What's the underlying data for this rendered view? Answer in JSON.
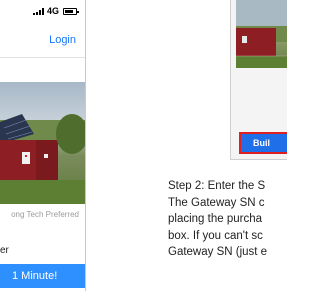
{
  "status_bar": {
    "network": "4G"
  },
  "header": {
    "login_label": "Login"
  },
  "hero": {
    "caption": "ong Tech Preferred"
  },
  "section": {
    "label": "er"
  },
  "cta": {
    "label": "1 Minute!"
  },
  "right_screen": {
    "button_label": "Buil"
  },
  "instructions": {
    "lines": [
      "Step 2: Enter the S",
      "The Gateway SN c",
      "placing the purcha",
      "box. If you can't sc",
      "Gateway SN (just e"
    ]
  }
}
